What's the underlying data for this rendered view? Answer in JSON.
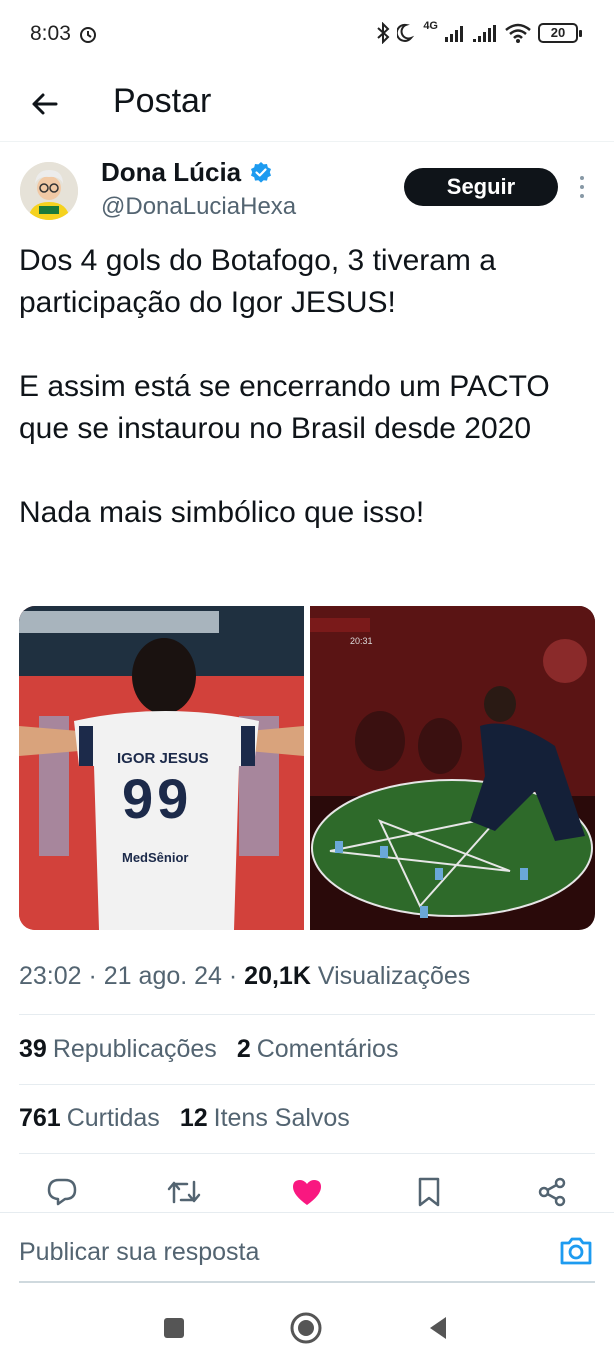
{
  "status_bar": {
    "time": "8:03",
    "network": "4G",
    "battery": "20",
    "icons": [
      "alarm-icon",
      "bluetooth-icon",
      "moon-icon",
      "signal-icon",
      "signal-icon",
      "wifi-icon",
      "battery-icon"
    ]
  },
  "header": {
    "title": "Postar",
    "back_icon": "arrow-left-icon"
  },
  "author": {
    "name": "Dona Lúcia",
    "handle": "@DonaLuciaHexa",
    "verified": true,
    "follow_label": "Seguir"
  },
  "tweet": {
    "text": "Dos 4 gols do Botafogo, 3 tiveram a participação do Igor JESUS!\n\nE assim está se encerrando um PACTO que se instaurou no Brasil desde 2020\n\nNada mais simbólico que isso!"
  },
  "media": {
    "left_image": {
      "shirt_name": "IGOR JESUS",
      "shirt_number": "99",
      "sponsor": "MedSênior"
    },
    "right_image": {
      "scoreboard": "20:31"
    }
  },
  "meta": {
    "time": "23:02",
    "date": "21 ago. 24",
    "views_count": "20,1K",
    "views_label": "Visualizações"
  },
  "stats": {
    "reposts_count": "39",
    "reposts_label": "Republicações",
    "comments_count": "2",
    "comments_label": "Comentários",
    "likes_count": "761",
    "likes_label": "Curtidas",
    "saves_count": "12",
    "saves_label": "Itens Salvos"
  },
  "actions": [
    "reply-icon",
    "repost-icon",
    "like-icon",
    "bookmark-icon",
    "share-icon"
  ],
  "like_color": "#f91880",
  "accent_color": "#1d9bf0",
  "reply": {
    "placeholder": "Publicar sua resposta"
  }
}
